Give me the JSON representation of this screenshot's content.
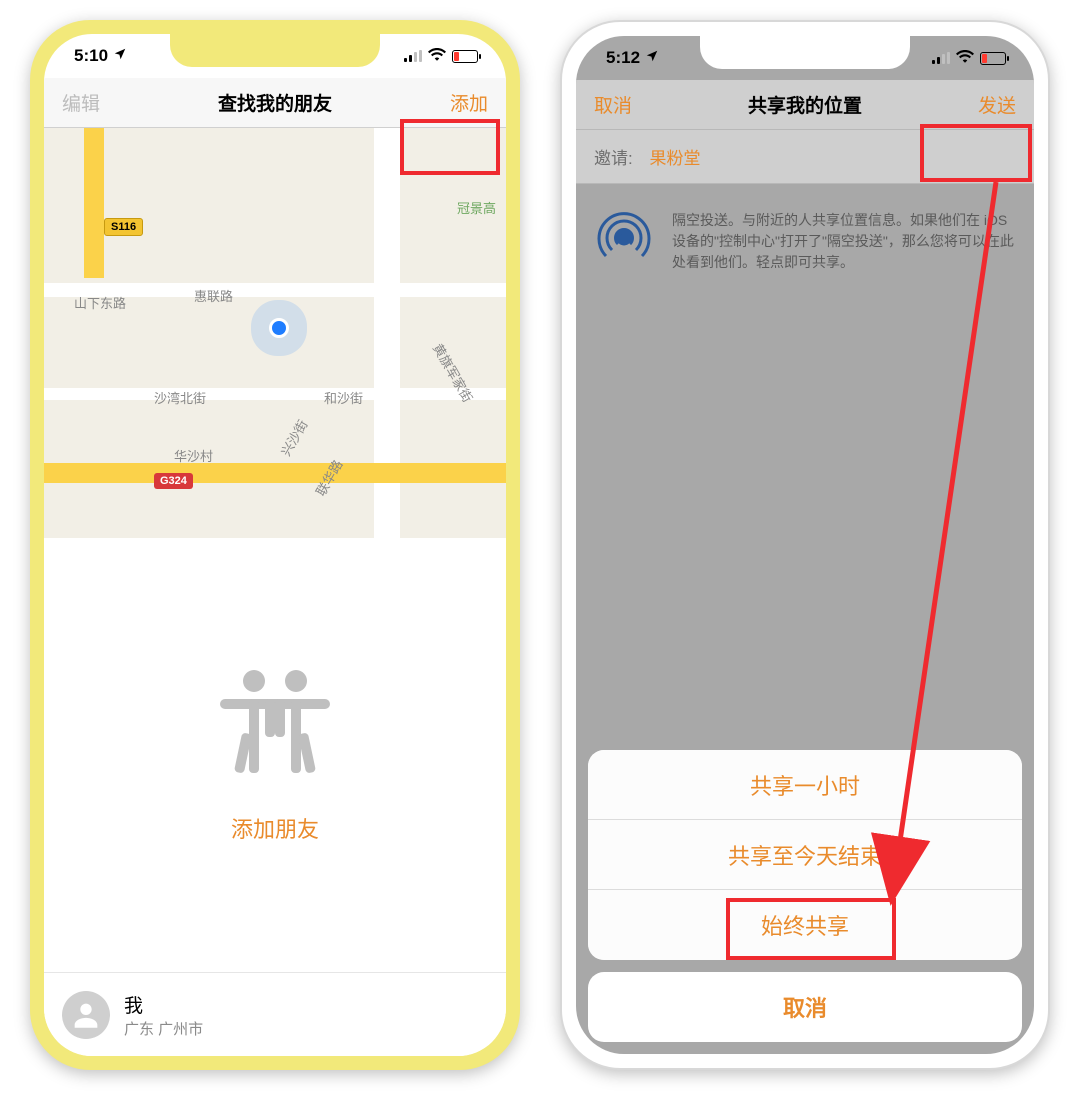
{
  "left": {
    "status_time": "5:10",
    "nav": {
      "left": "编辑",
      "title": "查找我的朋友",
      "right": "添加"
    },
    "map": {
      "labels": {
        "guanjing": "冠景高",
        "shanxia": "山下东路",
        "huilian": "惠联路",
        "shawan": "沙湾北街",
        "hesha": "和沙街",
        "huasha": "华沙村",
        "lianhua": "联华路",
        "xingsha": "兴沙街",
        "huangqi": "黄旗军家街"
      },
      "shields": {
        "s116": "S116",
        "g324": "G324"
      }
    },
    "add_friend_label": "添加朋友",
    "me": {
      "name": "我",
      "location": "广东 广州市"
    }
  },
  "right": {
    "status_time": "5:12",
    "nav": {
      "left": "取消",
      "title": "共享我的位置",
      "right": "发送"
    },
    "invite_label": "邀请:",
    "invite_name": "果粉堂",
    "airdrop_text": "隔空投送。与附近的人共享位置信息。如果他们在 iOS 设备的\"控制中心\"打开了\"隔空投送\"，那么您将可以在此处看到他们。轻点即可共享。",
    "actions": {
      "hour": "共享一小时",
      "today": "共享至今天结束",
      "always": "始终共享",
      "cancel": "取消"
    }
  },
  "colors": {
    "accent": "#e98b2c",
    "highlight": "#ef2a2f"
  }
}
